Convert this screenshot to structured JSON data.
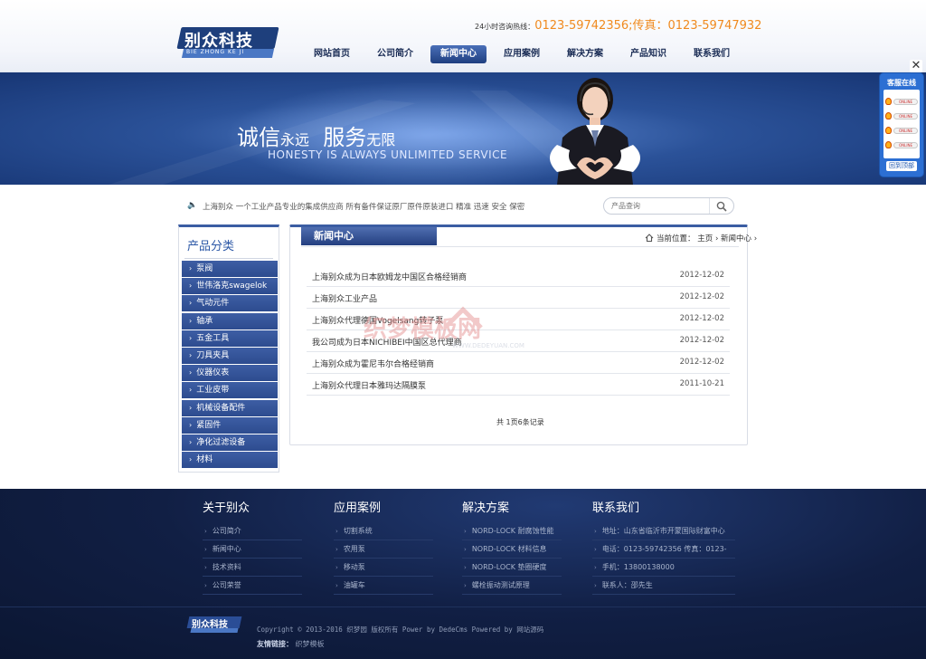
{
  "header": {
    "logo_text": "别众科技",
    "logo_sub": "BIE ZHONG KE JI",
    "hotline_label": "24小时咨询热线：",
    "hotline_value": "0123-59742356;传真：0123-59747932",
    "nav": [
      {
        "label": "网站首页",
        "active": false
      },
      {
        "label": "公司简介",
        "active": false
      },
      {
        "label": "新闻中心",
        "active": true
      },
      {
        "label": "应用案例",
        "active": false
      },
      {
        "label": "解决方案",
        "active": false
      },
      {
        "label": "产品知识",
        "active": false
      },
      {
        "label": "联系我们",
        "active": false
      }
    ]
  },
  "banner": {
    "title_a": "诚信",
    "title_b": "永远",
    "title_c": "服务",
    "title_d": "无限",
    "subtitle": "HONESTY IS ALWAYS UNLIMITED SERVICE"
  },
  "service": {
    "title": "客服在线",
    "online_label": "ONLINE",
    "back_label": "回到顶部",
    "close": "✕"
  },
  "notice": {
    "text": "上海别众 一个工业产品专业的集成供应商 所有备件保证原厂原件原装进口 精准 迅速 安全 保密"
  },
  "search": {
    "placeholder": "产品查询"
  },
  "sidebar": {
    "title": "产品分类",
    "items": [
      "泵阀",
      "世伟洛克swagelok",
      "气动元件",
      "轴承",
      "五金工具",
      "刀具夹具",
      "仪器仪表",
      "工业皮带",
      "机械设备配件",
      "紧固件",
      "净化过滤设备",
      "材料"
    ]
  },
  "main": {
    "tab": "新闻中心",
    "crumb_label": "当前位置：",
    "crumb_home": "主页",
    "crumb_current": "新闻中心",
    "news": [
      {
        "title": "上海别众成为日本欧姆龙中国区合格经销商",
        "date": "2012-12-02"
      },
      {
        "title": "上海别众工业产品",
        "date": "2012-12-02"
      },
      {
        "title": "上海别众代理德国Vogelsang转子泵",
        "date": "2012-12-02"
      },
      {
        "title": "我公司成为日本NICHIBEI中国区总代理商",
        "date": "2012-12-02"
      },
      {
        "title": "上海别众成为霍尼韦尔合格经销商",
        "date": "2012-12-02"
      },
      {
        "title": "上海别众代理日本雅玛达隔膜泵",
        "date": "2011-10-21"
      }
    ],
    "pager": "共 1页6条记录"
  },
  "watermark": {
    "cn": "织梦模板网",
    "en": "WWW.DEDEYUAN.COM"
  },
  "footer": {
    "columns": [
      {
        "title": "关于别众",
        "links": [
          "公司简介",
          "新闻中心",
          "技术资料",
          "公司荣誉"
        ]
      },
      {
        "title": "应用案例",
        "links": [
          "切割系统",
          "农用泵",
          "移动泵",
          "油罐车"
        ]
      },
      {
        "title": "解决方案",
        "links": [
          "NORD-LOCK 耐腐蚀性能",
          "NORD-LOCK 材料信息",
          "NORD-LOCK 垫圈硬度",
          "螺栓振动测试原理"
        ]
      },
      {
        "title": "联系我们",
        "links": [
          "地址：山东省临沂市开蒙国际财富中心",
          "电话：0123-59742356 传真：0123-",
          "手机：13800138000",
          "联系人：邵先生"
        ]
      }
    ],
    "logo_text": "别众科技",
    "copyright": "Copyright © 2013-2016 织梦园 版权所有 Power by DedeCms Powered by 网站源码",
    "friend_label": "友情链接：",
    "friend_link": "织梦模板"
  },
  "colors": {
    "brand_navy": "#1e3f7c",
    "accent_orange": "#f08a1e",
    "banner_blue": "#2b5299",
    "service_blue": "#2c6fd3"
  }
}
